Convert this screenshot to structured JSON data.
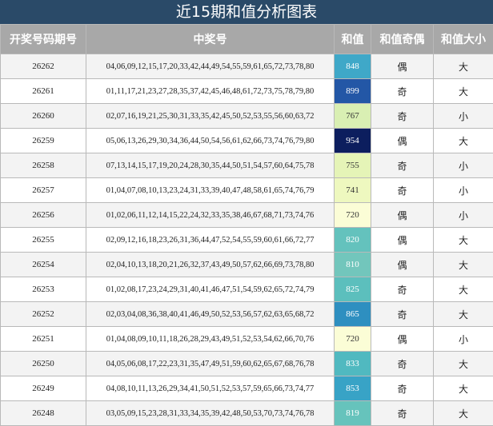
{
  "title": "近15期和值分析图表",
  "columns": [
    "开奖号码期号",
    "中奖号",
    "和值",
    "和值奇偶",
    "和值大小"
  ],
  "rows": [
    {
      "period": "26262",
      "numbers": "04,06,09,12,15,17,20,33,42,44,49,54,55,59,61,65,72,73,78,80",
      "sum": "848",
      "parity": "偶",
      "size": "大",
      "color": "#3fa8c8",
      "text": "#ffffff"
    },
    {
      "period": "26261",
      "numbers": "01,11,17,21,23,27,28,35,37,42,45,46,48,61,72,73,75,78,79,80",
      "sum": "899",
      "parity": "奇",
      "size": "大",
      "color": "#2357a6",
      "text": "#ffffff"
    },
    {
      "period": "26260",
      "numbers": "02,07,16,19,21,25,30,31,33,35,42,45,50,52,53,55,56,60,63,72",
      "sum": "767",
      "parity": "奇",
      "size": "小",
      "color": "#d9efb3",
      "text": "#333333"
    },
    {
      "period": "26259",
      "numbers": "05,06,13,26,29,30,34,36,44,50,54,56,61,62,66,73,74,76,79,80",
      "sum": "954",
      "parity": "偶",
      "size": "大",
      "color": "#0c1e5e",
      "text": "#ffffff"
    },
    {
      "period": "26258",
      "numbers": "07,13,14,15,17,19,20,24,28,30,35,44,50,51,54,57,60,64,75,78",
      "sum": "755",
      "parity": "奇",
      "size": "小",
      "color": "#e5f4b7",
      "text": "#333333"
    },
    {
      "period": "26257",
      "numbers": "01,04,07,08,10,13,23,24,31,33,39,40,47,48,58,61,65,74,76,79",
      "sum": "741",
      "parity": "奇",
      "size": "小",
      "color": "#eef8bf",
      "text": "#333333"
    },
    {
      "period": "26256",
      "numbers": "01,02,06,11,12,14,15,22,24,32,33,35,38,46,67,68,71,73,74,76",
      "sum": "720",
      "parity": "偶",
      "size": "小",
      "color": "#fbfdd6",
      "text": "#333333"
    },
    {
      "period": "26255",
      "numbers": "02,09,12,16,18,23,26,31,36,44,47,52,54,55,59,60,61,66,72,77",
      "sum": "820",
      "parity": "偶",
      "size": "大",
      "color": "#64c2bd",
      "text": "#ffffff"
    },
    {
      "period": "26254",
      "numbers": "02,04,10,13,18,20,21,26,32,37,43,49,50,57,62,66,69,73,78,80",
      "sum": "810",
      "parity": "偶",
      "size": "大",
      "color": "#72c6bc",
      "text": "#ffffff"
    },
    {
      "period": "26253",
      "numbers": "01,02,08,17,23,24,29,31,40,41,46,47,51,54,59,62,65,72,74,79",
      "sum": "825",
      "parity": "奇",
      "size": "大",
      "color": "#5cbfbd",
      "text": "#ffffff"
    },
    {
      "period": "26252",
      "numbers": "02,03,04,08,36,38,40,41,46,49,50,52,53,56,57,62,63,65,68,72",
      "sum": "865",
      "parity": "奇",
      "size": "大",
      "color": "#2e8fc0",
      "text": "#ffffff"
    },
    {
      "period": "26251",
      "numbers": "01,04,08,09,10,11,18,26,28,29,43,49,51,52,53,54,62,66,70,76",
      "sum": "720",
      "parity": "偶",
      "size": "小",
      "color": "#fbfdd6",
      "text": "#333333"
    },
    {
      "period": "26250",
      "numbers": "04,05,06,08,17,22,23,31,35,47,49,51,59,60,62,65,67,68,76,78",
      "sum": "833",
      "parity": "奇",
      "size": "大",
      "color": "#50b9c0",
      "text": "#ffffff"
    },
    {
      "period": "26249",
      "numbers": "04,08,10,11,13,26,29,34,41,50,51,52,53,57,59,65,66,73,74,77",
      "sum": "853",
      "parity": "奇",
      "size": "大",
      "color": "#38a3c6",
      "text": "#ffffff"
    },
    {
      "period": "26248",
      "numbers": "03,05,09,15,23,28,31,33,34,35,39,42,48,50,53,70,73,74,76,78",
      "sum": "819",
      "parity": "奇",
      "size": "大",
      "color": "#66c3bc",
      "text": "#ffffff"
    }
  ]
}
